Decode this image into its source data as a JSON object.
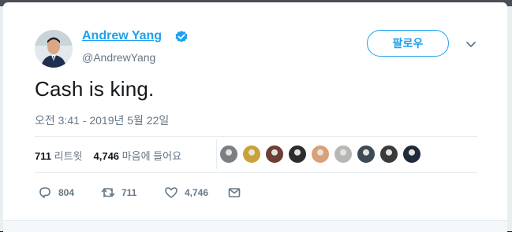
{
  "tweet": {
    "author_name": "Andrew Yang",
    "author_handle": "@AndrewYang",
    "verified_icon": "verified-badge-icon",
    "follow_label": "팔로우",
    "text": "Cash is king.",
    "timestamp": "오전 3:41 - 2019년 5월 22일"
  },
  "stats": {
    "retweets_count": "711",
    "retweets_label": "리트윗",
    "likes_count": "4,746",
    "likes_label": "마음에 들어요"
  },
  "liker_avatars": [
    {
      "name": "liker-avatar-1",
      "color": "#7a7f86"
    },
    {
      "name": "liker-avatar-2",
      "color": "#c9a23a"
    },
    {
      "name": "liker-avatar-3",
      "color": "#6b3f35"
    },
    {
      "name": "liker-avatar-4",
      "color": "#2d2d2d"
    },
    {
      "name": "liker-avatar-5",
      "color": "#d9a079"
    },
    {
      "name": "liker-avatar-6",
      "color": "#b7b7b7"
    },
    {
      "name": "liker-avatar-7",
      "color": "#3d4b57"
    },
    {
      "name": "liker-avatar-8",
      "color": "#3a3a3a"
    },
    {
      "name": "liker-avatar-9",
      "color": "#1f2b3a"
    }
  ],
  "actions": {
    "reply_count": "804",
    "retweet_count": "711",
    "like_count": "4,746"
  },
  "colors": {
    "accent": "#1da1f2",
    "muted": "#657786",
    "text": "#14171a"
  }
}
